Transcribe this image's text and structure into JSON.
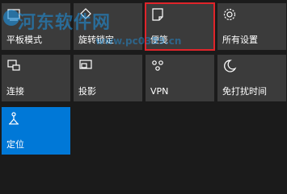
{
  "tiles": [
    {
      "label": "平板模式",
      "icon": "tablet-mode-icon"
    },
    {
      "label": "旋转锁定",
      "icon": "rotation-lock-icon"
    },
    {
      "label": "便笺",
      "icon": "note-icon"
    },
    {
      "label": "所有设置",
      "icon": "gear-icon"
    },
    {
      "label": "连接",
      "icon": "connect-icon"
    },
    {
      "label": "投影",
      "icon": "project-icon"
    },
    {
      "label": "VPN",
      "icon": "vpn-icon"
    },
    {
      "label": "免打扰时间",
      "icon": "moon-icon"
    },
    {
      "label": "定位",
      "icon": "location-icon"
    }
  ],
  "watermark": {
    "text": "河东软件网",
    "url": "www.pc0359.cn"
  },
  "colors": {
    "tile": "#3b3b3b",
    "active": "#0078d7",
    "highlight": "#e0242a",
    "background": "#1b1b1b"
  }
}
